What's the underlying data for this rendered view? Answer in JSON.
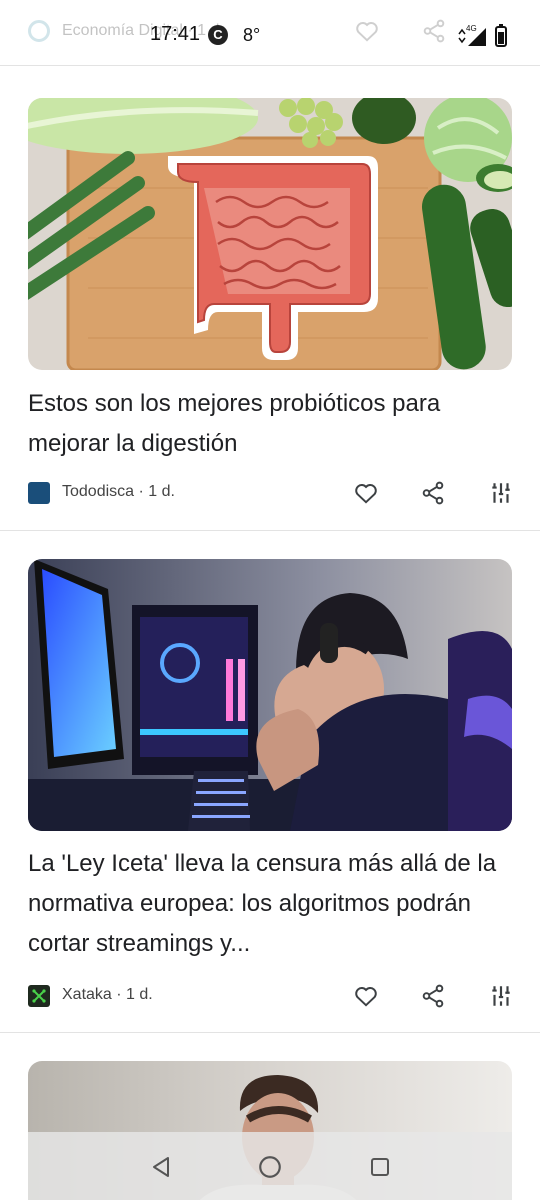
{
  "status_bar": {
    "time": "17:41",
    "carrier_badge": "C",
    "temperature": "8°",
    "network": "4G"
  },
  "faded_header": {
    "source_text": "Economía Digital · 1 d."
  },
  "feed": {
    "cards": [
      {
        "title": "Estos son los mejores probióticos para mejorar la digestión",
        "source": "Tododisca",
        "age": "1 d.",
        "source_logo_color": "#1a4e7a",
        "image": "intestine-on-cutting-board"
      },
      {
        "title": "La 'Ley Iceta' lleva la censura más allá de la normativa europea: los algoritmos podrán cortar streamings y...",
        "source": "Xataka",
        "age": "1 d.",
        "source_logo_color": "#1f2a1f",
        "image": "frustrated-gamer-at-pc"
      }
    ]
  },
  "icons": {
    "like": "heart-icon",
    "share": "share-icon",
    "more": "tune-icon",
    "nav_back": "back-triangle-icon",
    "nav_home": "home-circle-icon",
    "nav_recents": "recents-square-icon"
  }
}
